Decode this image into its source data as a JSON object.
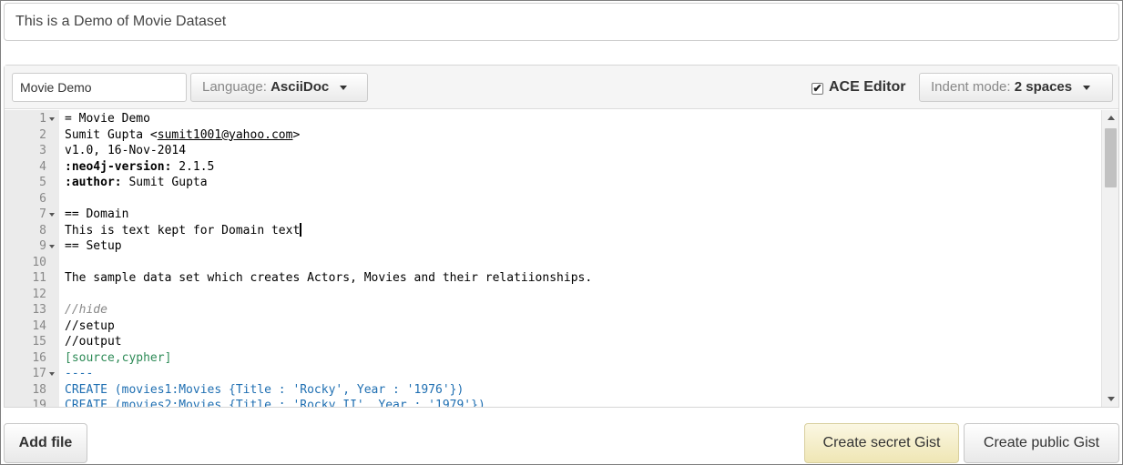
{
  "description": {
    "value": "This is a Demo of Movie Dataset"
  },
  "file": {
    "name": "Movie Demo",
    "language_label": "Language:",
    "language_value": "AsciiDoc",
    "ace_editor_label": "ACE Editor",
    "ace_editor_checked": true,
    "indent_label": "Indent mode:",
    "indent_value": "2 spaces"
  },
  "editor": {
    "lines": [
      {
        "num": "1",
        "fold": true,
        "segments": [
          {
            "t": "= Movie Demo",
            "s": "plain"
          }
        ]
      },
      {
        "num": "2",
        "fold": false,
        "segments": [
          {
            "t": "Sumit Gupta <",
            "s": "plain"
          },
          {
            "t": "sumit1001@yahoo.com",
            "s": "link"
          },
          {
            "t": ">",
            "s": "plain"
          }
        ]
      },
      {
        "num": "3",
        "fold": false,
        "segments": [
          {
            "t": "v1.0, 16-Nov-2014",
            "s": "plain"
          }
        ]
      },
      {
        "num": "4",
        "fold": false,
        "segments": [
          {
            "t": ":neo4j-version:",
            "s": "bold"
          },
          {
            "t": " 2.1.5",
            "s": "plain"
          }
        ]
      },
      {
        "num": "5",
        "fold": false,
        "segments": [
          {
            "t": ":author:",
            "s": "bold"
          },
          {
            "t": " Sumit Gupta",
            "s": "plain"
          }
        ]
      },
      {
        "num": "6",
        "fold": false,
        "segments": []
      },
      {
        "num": "7",
        "fold": true,
        "segments": [
          {
            "t": "== Domain",
            "s": "plain"
          }
        ]
      },
      {
        "num": "8",
        "fold": false,
        "segments": [
          {
            "t": "This is text kept for Domain text",
            "s": "plain"
          }
        ],
        "cursor": true
      },
      {
        "num": "9",
        "fold": true,
        "segments": [
          {
            "t": "== Setup",
            "s": "plain"
          }
        ]
      },
      {
        "num": "10",
        "fold": false,
        "segments": []
      },
      {
        "num": "11",
        "fold": false,
        "segments": [
          {
            "t": "The sample data set which creates Actors, Movies and their relatiionships.",
            "s": "plain"
          }
        ]
      },
      {
        "num": "12",
        "fold": false,
        "segments": []
      },
      {
        "num": "13",
        "fold": false,
        "segments": [
          {
            "t": "//hide",
            "s": "comment"
          }
        ]
      },
      {
        "num": "14",
        "fold": false,
        "segments": [
          {
            "t": "//setup",
            "s": "plain"
          }
        ]
      },
      {
        "num": "15",
        "fold": false,
        "segments": [
          {
            "t": "//output",
            "s": "plain"
          }
        ]
      },
      {
        "num": "16",
        "fold": false,
        "segments": [
          {
            "t": "[source,cypher]",
            "s": "green"
          }
        ]
      },
      {
        "num": "17",
        "fold": true,
        "segments": [
          {
            "t": "----",
            "s": "blue"
          }
        ]
      },
      {
        "num": "18",
        "fold": false,
        "segments": [
          {
            "t": "CREATE (movies1:Movies {Title : 'Rocky', Year : '1976'})",
            "s": "blue"
          }
        ]
      },
      {
        "num": "19",
        "fold": false,
        "segments": [
          {
            "t": "CREATE (movies2:Movies {Title : 'Rocky II', Year : '1979'})",
            "s": "blue"
          }
        ]
      }
    ]
  },
  "footer": {
    "add_file_label": "Add file",
    "create_secret_label": "Create secret Gist",
    "create_public_label": "Create public Gist"
  },
  "colors": {
    "secret_button": "#efe6b4",
    "code_keyword_blue": "#1f6fb2",
    "code_green": "#2e8b57",
    "code_comment": "#888888"
  }
}
